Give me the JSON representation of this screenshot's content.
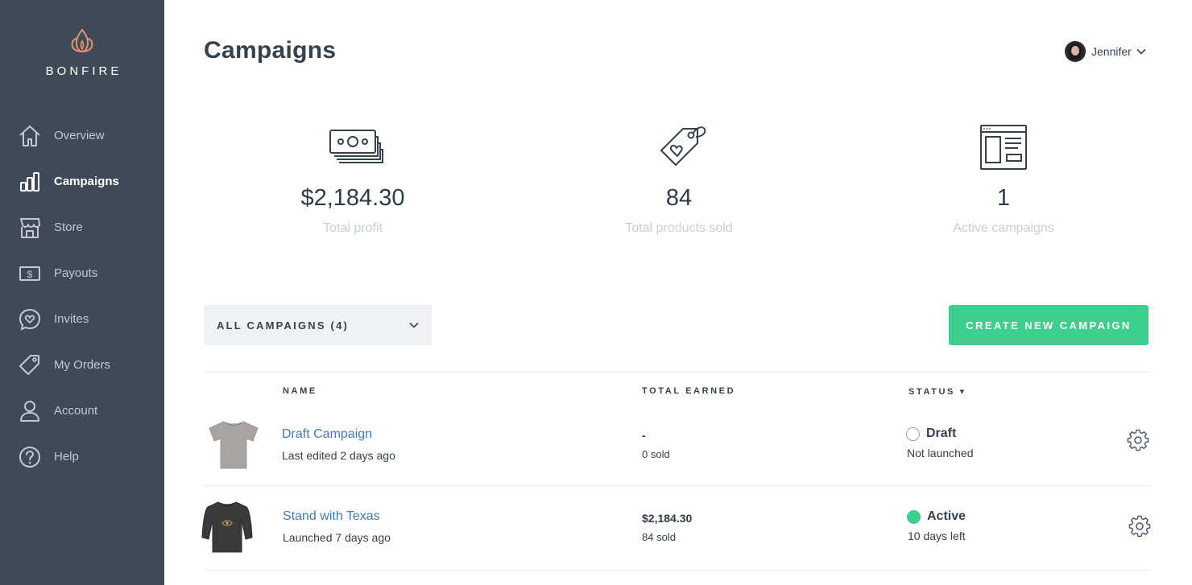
{
  "sidebar": {
    "brand": "BONFIRE",
    "items": [
      {
        "label": "Overview",
        "icon": "home-icon"
      },
      {
        "label": "Campaigns",
        "icon": "bar-chart-icon",
        "active": true
      },
      {
        "label": "Store",
        "icon": "storefront-icon"
      },
      {
        "label": "Payouts",
        "icon": "dollar-bill-icon"
      },
      {
        "label": "Invites",
        "icon": "heart-chat-icon"
      },
      {
        "label": "My Orders",
        "icon": "tag-icon"
      },
      {
        "label": "Account",
        "icon": "person-icon"
      },
      {
        "label": "Help",
        "icon": "question-circle-icon"
      }
    ]
  },
  "header": {
    "title": "Campaigns",
    "user": "Jennifer"
  },
  "stats": [
    {
      "value": "$2,184.30",
      "label": "Total profit",
      "icon": "money-stack-icon"
    },
    {
      "value": "84",
      "label": "Total products sold",
      "icon": "price-tag-heart-icon"
    },
    {
      "value": "1",
      "label": "Active campaigns",
      "icon": "browser-window-icon"
    }
  ],
  "controls": {
    "filter_label": "ALL CAMPAIGNS (4)",
    "create_label": "CREATE NEW CAMPAIGN"
  },
  "table": {
    "columns": [
      "NAME",
      "TOTAL EARNED",
      "STATUS ▾"
    ],
    "rows": [
      {
        "name": "Draft Campaign",
        "sub": "Last edited 2 days ago",
        "earned": "-",
        "sold": "0 sold",
        "status": "Draft",
        "status_sub": "Not launched",
        "product": "gray-tshirt"
      },
      {
        "name": "Stand with Texas",
        "sub": "Launched 7 days ago",
        "earned": "$2,184.30",
        "sold": "84 sold",
        "status": "Active",
        "status_sub": "10 days left",
        "product": "black-longsleeve"
      }
    ]
  },
  "colors": {
    "sidebar_bg": "#3e4a57",
    "accent": "#3ecf8e",
    "link": "#4479b9",
    "brand_orange": "#e8916a"
  }
}
